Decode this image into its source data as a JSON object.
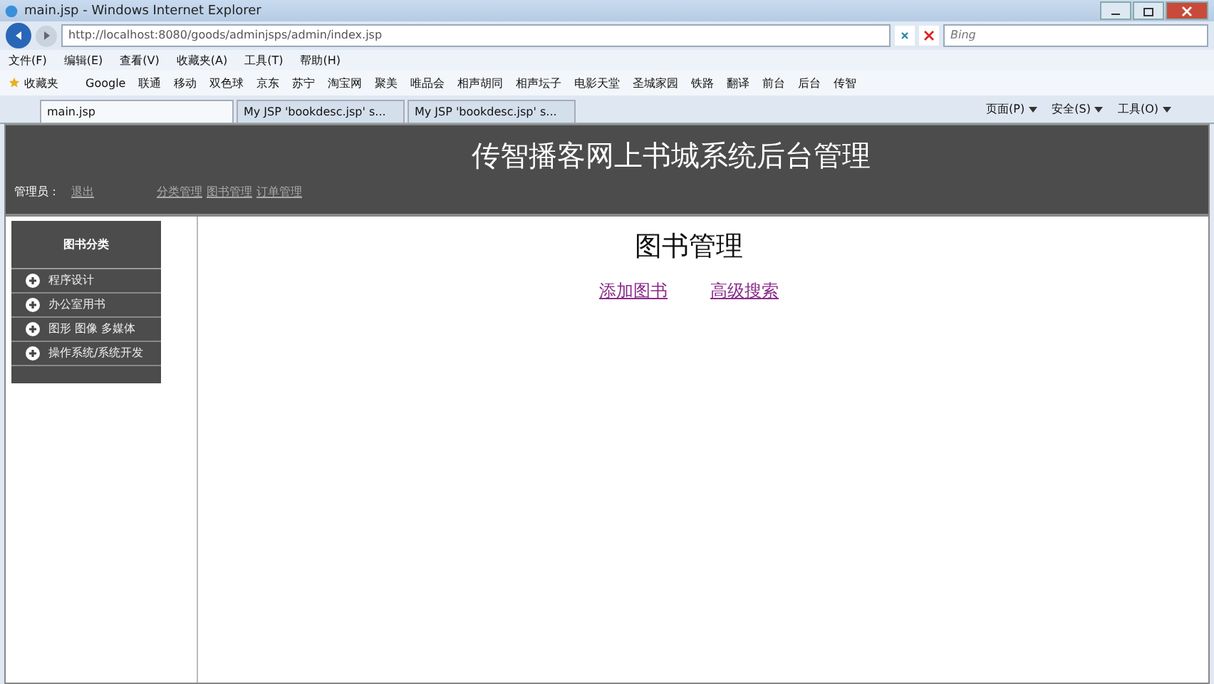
{
  "window": {
    "title": "main.jsp - Windows Internet Explorer"
  },
  "address_bar": {
    "url": "http://localhost:8080/goods/adminjsps/admin/index.jsp"
  },
  "search": {
    "placeholder": "Bing"
  },
  "menu": [
    "文件(F)",
    "编辑(E)",
    "查看(V)",
    "收藏夹(A)",
    "工具(T)",
    "帮助(H)"
  ],
  "favorites_bar": {
    "label": "收藏夹",
    "items": [
      "Google",
      "联通",
      "移动",
      "双色球",
      "京东",
      "苏宁",
      "淘宝网",
      "聚美",
      "唯品会",
      "相声胡同",
      "相声坛子",
      "电影天堂",
      "圣城家园",
      "铁路",
      "翻译",
      "前台",
      "后台",
      "传智"
    ]
  },
  "tabs": [
    {
      "label": "main.jsp",
      "selected": true
    },
    {
      "label": "My JSP 'bookdesc.jsp' s...",
      "selected": false
    },
    {
      "label": "My JSP 'bookdesc.jsp' s...",
      "selected": false
    }
  ],
  "command_bar": [
    "页面(P)",
    "安全(S)",
    "工具(O)"
  ],
  "page": {
    "title": "传智播客网上书城系统后台管理",
    "admin_label": "管理员：",
    "logout": "退出",
    "nav": [
      "分类管理",
      "图书管理",
      "订单管理"
    ],
    "sidebar": {
      "title": "图书分类",
      "items": [
        "程序设计",
        "办公室用书",
        "图形 图像 多媒体",
        "操作系统/系统开发"
      ]
    },
    "main": {
      "heading": "图书管理",
      "links": [
        "添加图书",
        "高级搜索"
      ]
    }
  }
}
